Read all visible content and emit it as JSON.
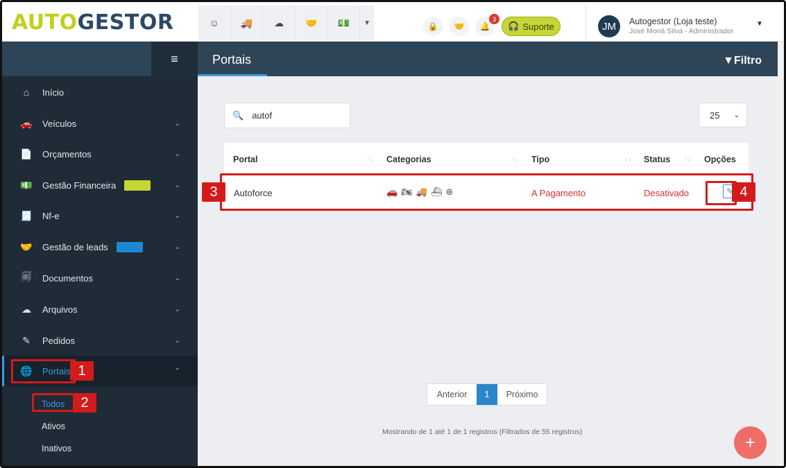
{
  "header": {
    "logo_a": "AUTO",
    "logo_b": "GESTOR",
    "notification_count": "3",
    "support_label": "Suporte",
    "user_initials": "JM",
    "user_name": "Autogestor (Loja teste)",
    "user_role": "José Moriá Silva - Administrador",
    "quick_icons": [
      "smile-icon",
      "car-plus-icon",
      "cloud-upload-icon",
      "handshake-icon",
      "money-icon"
    ]
  },
  "sidebar": {
    "items": [
      {
        "label": "Início",
        "icon": "home-icon"
      },
      {
        "label": "Veículos",
        "icon": "car-icon"
      },
      {
        "label": "Orçamentos",
        "icon": "file-icon"
      },
      {
        "label": "Gestão Financeira",
        "icon": "money-icon",
        "pill_color": "#c6d634"
      },
      {
        "label": "Nf-e",
        "icon": "invoice-icon"
      },
      {
        "label": "Gestão de leads",
        "icon": "handshake-icon",
        "pill_color": "#1e88d4"
      },
      {
        "label": "Documentos",
        "icon": "documents-icon"
      },
      {
        "label": "Arquivos",
        "icon": "cloud-upload-icon"
      },
      {
        "label": "Pedidos",
        "icon": "edit-icon"
      },
      {
        "label": "Portais",
        "icon": "globe-icon"
      }
    ],
    "sub_items": [
      "Todos",
      "Ativos",
      "Inativos"
    ]
  },
  "main": {
    "title": "Portais",
    "filter_label": "Filtro",
    "search_value": "autof",
    "page_size": "25",
    "columns": [
      "Portal",
      "Categorias",
      "Tipo",
      "Status",
      "Opções"
    ],
    "rows": [
      {
        "portal": "Autoforce",
        "categories": [
          "car-icon",
          "motorcycle-icon",
          "truck-icon",
          "boat-icon",
          "plus-circle-icon"
        ],
        "tipo": "A Pagamento",
        "status": "Desativado"
      }
    ],
    "pager": {
      "prev": "Anterior",
      "current": "1",
      "next": "Próximo"
    },
    "showing": "Mostrando de 1 até 1 de 1 registros (Filtrados de 55 registros)"
  },
  "annotations": [
    "1",
    "2",
    "3",
    "4"
  ],
  "colors": {
    "accent": "#3a9be0",
    "brand_lime": "#c6d634",
    "brand_navy": "#2e4457",
    "danger": "#d31b1b",
    "fab": "#ef6d67"
  }
}
